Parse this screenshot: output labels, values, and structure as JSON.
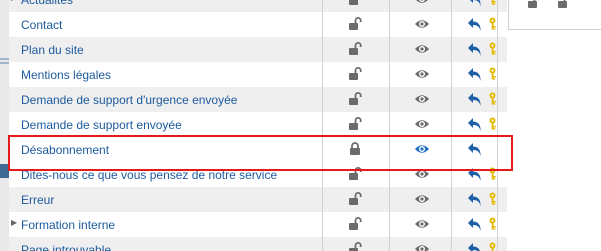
{
  "pages": [
    {
      "label": "Actualités",
      "expandable": true,
      "lock": "open",
      "eye": "gray"
    },
    {
      "label": "Contact",
      "expandable": false,
      "lock": "open",
      "eye": "gray"
    },
    {
      "label": "Plan du site",
      "expandable": false,
      "lock": "open",
      "eye": "gray"
    },
    {
      "label": "Mentions légales",
      "expandable": false,
      "lock": "open",
      "eye": "gray"
    },
    {
      "label": "Demande de support d'urgence envoyée",
      "expandable": false,
      "lock": "open",
      "eye": "gray"
    },
    {
      "label": "Demande de support envoyée",
      "expandable": false,
      "lock": "open",
      "eye": "gray"
    },
    {
      "label": "Désabonnement",
      "expandable": false,
      "lock": "closed",
      "eye": "blue",
      "selected": true
    },
    {
      "label": "Dites-nous ce que vous pensez de notre service",
      "expandable": false,
      "lock": "open",
      "eye": "gray"
    },
    {
      "label": "Erreur",
      "expandable": false,
      "lock": "open",
      "eye": "gray"
    },
    {
      "label": "Formation interne",
      "expandable": true,
      "lock": "open",
      "eye": "gray"
    },
    {
      "label": "Page introuvable",
      "expandable": false,
      "lock": "open",
      "eye": "gray"
    }
  ],
  "colors": {
    "link": "#1c5a9e",
    "highlight": "#e31b1b",
    "eye_active": "#1f6fc5",
    "icon_gray": "#6b6b6b",
    "key": "#e4b800"
  },
  "icons": {
    "lock_open": "unlocked-padlock-icon",
    "lock_closed": "locked-padlock-icon",
    "eye": "eye-icon",
    "undo": "undo-arrow-icon",
    "key": "key-icon"
  }
}
